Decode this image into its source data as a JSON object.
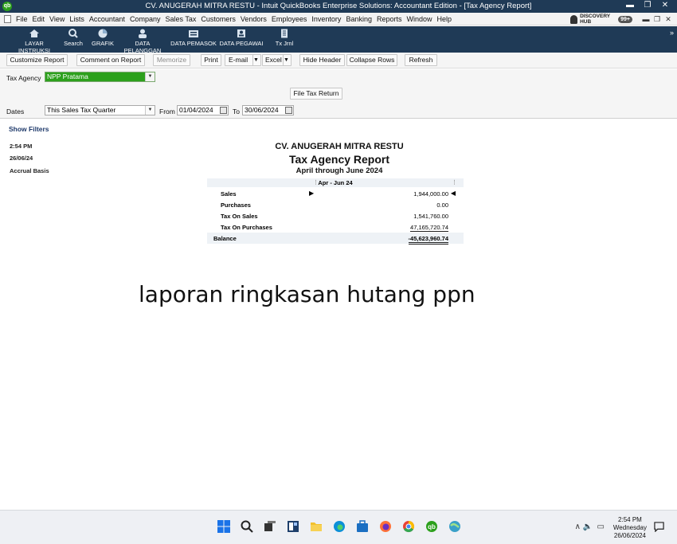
{
  "window": {
    "logo": "qb",
    "title": "CV. ANUGERAH MITRA RESTU  - Intuit QuickBooks Enterprise Solutions: Accountant Edition - [Tax Agency Report]"
  },
  "menu": {
    "items": [
      "File",
      "Edit",
      "View",
      "Lists",
      "Accountant",
      "Company",
      "Sales Tax",
      "Customers",
      "Vendors",
      "Employees",
      "Inventory",
      "Banking",
      "Reports",
      "Window",
      "Help"
    ],
    "discovery_line1": "DISCOVERY",
    "discovery_line2": "HUB",
    "notification_count": "99+"
  },
  "toolbar": {
    "items": [
      {
        "label": "LAYAR INSTRUKSI",
        "icon": "home-icon"
      },
      {
        "label": "Search",
        "icon": "search-icon"
      },
      {
        "label": "GRAFIK",
        "icon": "pie-chart-icon"
      },
      {
        "label": "DATA PELANGGAN",
        "icon": "person-icon"
      },
      {
        "label": "DATA PEMASOK",
        "icon": "vendor-icon"
      },
      {
        "label": "DATA PEGAWAI",
        "icon": "employee-icon"
      },
      {
        "label": "Tx Jrnl",
        "icon": "journal-icon"
      }
    ],
    "expand": "»"
  },
  "report_buttons": {
    "customize": "Customize Report",
    "comment": "Comment on Report",
    "memorize": "Memorize",
    "print": "Print",
    "email": "E-mail",
    "excel": "Excel",
    "hide_header": "Hide Header",
    "collapse_rows": "Collapse Rows",
    "refresh": "Refresh"
  },
  "filters": {
    "tax_agency_label": "Tax Agency",
    "tax_agency_value": "NPP Pratama",
    "file_tax_return": "File Tax Return",
    "dates_label": "Dates",
    "dates_value": "This Sales Tax Quarter",
    "from_label": "From",
    "from_value": "01/04/2024",
    "to_label": "To",
    "to_value": "30/06/2024"
  },
  "report": {
    "show_filters": "Show Filters",
    "time": "2:54 PM",
    "date": "26/06/24",
    "basis": "Accrual Basis",
    "company": "CV. ANUGERAH MITRA RESTU",
    "title": "Tax Agency Report",
    "period": "April through June 2024",
    "column": "Apr - Jun 24",
    "rows": [
      {
        "label": "Sales",
        "value": "1,944,000.00"
      },
      {
        "label": "Purchases",
        "value": "0.00"
      },
      {
        "label": "Tax On Sales",
        "value": "1,541,760.00"
      },
      {
        "label": "Tax On Purchases",
        "value": "47,165,720.74"
      }
    ],
    "balance_label": "Balance",
    "balance_value": "-45,623,960.74"
  },
  "overlay_caption": "laporan ringkasan hutang ppn",
  "taskbar": {
    "time": "2:54 PM",
    "day": "Wednesday",
    "date": "26/06/2024"
  }
}
